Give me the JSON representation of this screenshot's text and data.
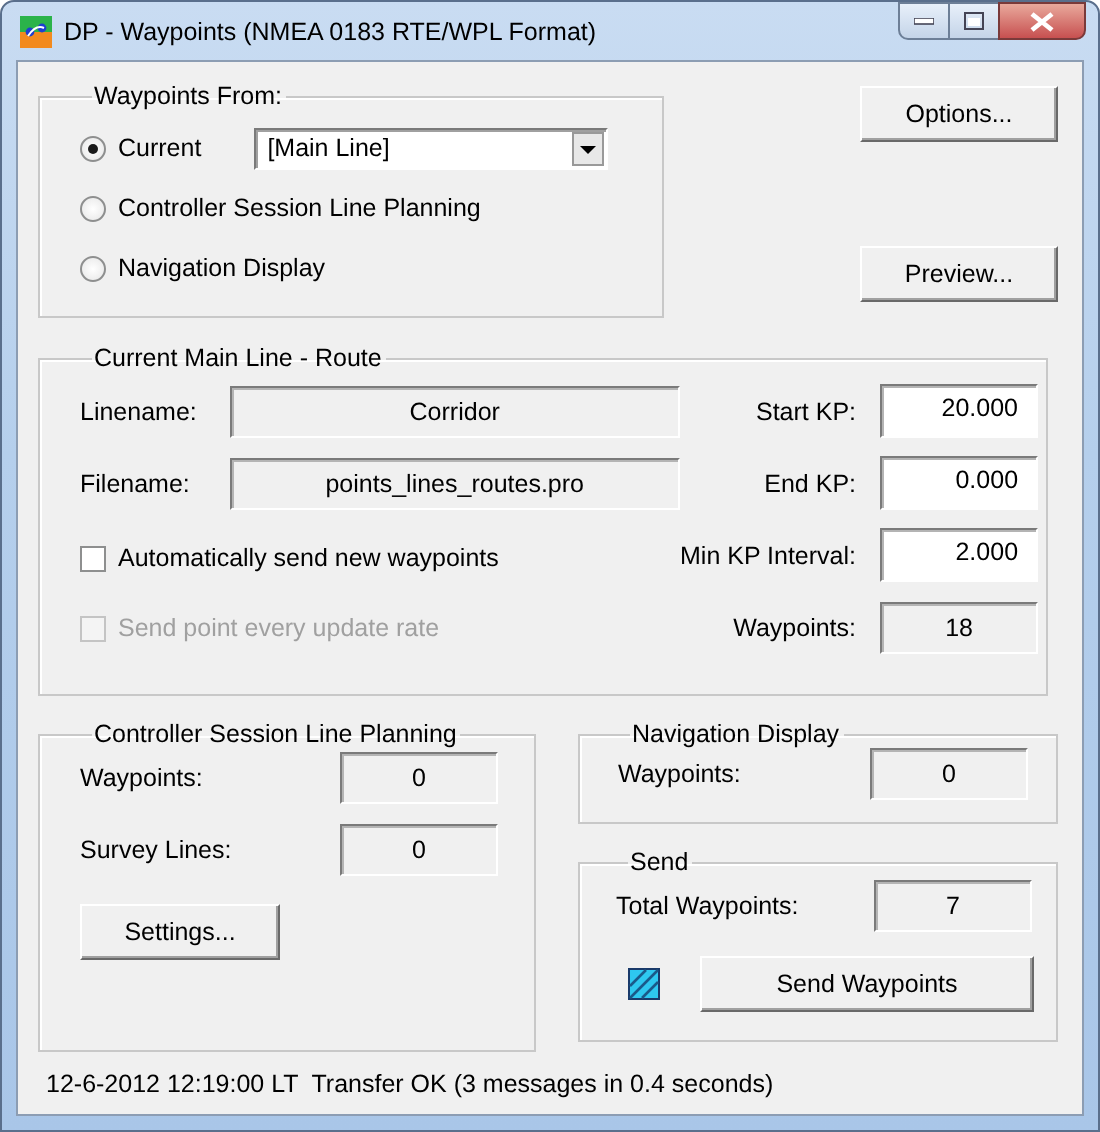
{
  "window": {
    "title": "DP - Waypoints (NMEA 0183 RTE/WPL Format)"
  },
  "waypoints_from": {
    "title": "Waypoints From:",
    "options": [
      {
        "label": "Current",
        "selected": true
      },
      {
        "label": "Controller Session Line Planning",
        "selected": false
      },
      {
        "label": "Navigation Display",
        "selected": false
      }
    ],
    "dropdown": {
      "value": "[Main Line]"
    }
  },
  "buttons": [
    {
      "label": "Options..."
    },
    {
      "label": "Preview..."
    }
  ],
  "current_route": {
    "title": "Current Main Line - Route",
    "linename": {
      "label": "Linename:",
      "value": "Corridor"
    },
    "filename": {
      "label": "Filename:",
      "value": "points_lines_routes.pro"
    },
    "checkboxes": [
      {
        "label": "Automatically send new waypoints",
        "checked": false,
        "disabled": false
      },
      {
        "label": "Send point every update rate",
        "checked": false,
        "disabled": true
      }
    ],
    "start_kp": {
      "label": "Start KP:",
      "value": "20.000"
    },
    "end_kp": {
      "label": "End KP:",
      "value": "0.000"
    },
    "min_kp_interval": {
      "label": "Min KP Interval:",
      "value": "2.000"
    },
    "waypoints": {
      "label": "Waypoints:",
      "value": "18"
    }
  },
  "controller_session": {
    "title": "Controller Session Line Planning",
    "waypoints": {
      "label": "Waypoints:",
      "value": "0"
    },
    "survey_lines": {
      "label": "Survey Lines:",
      "value": "0"
    },
    "settings_button": {
      "label": "Settings..."
    }
  },
  "navigation_display": {
    "title": "Navigation Display",
    "waypoints": {
      "label": "Waypoints:",
      "value": "0"
    }
  },
  "send": {
    "title": "Send",
    "total_waypoints": {
      "label": "Total Waypoints:",
      "value": "7"
    },
    "send_button": {
      "label": "Send Waypoints"
    }
  },
  "status_bar": "12-6-2012 12:19:00 LT  Transfer OK (3 messages in 0.4 seconds)"
}
